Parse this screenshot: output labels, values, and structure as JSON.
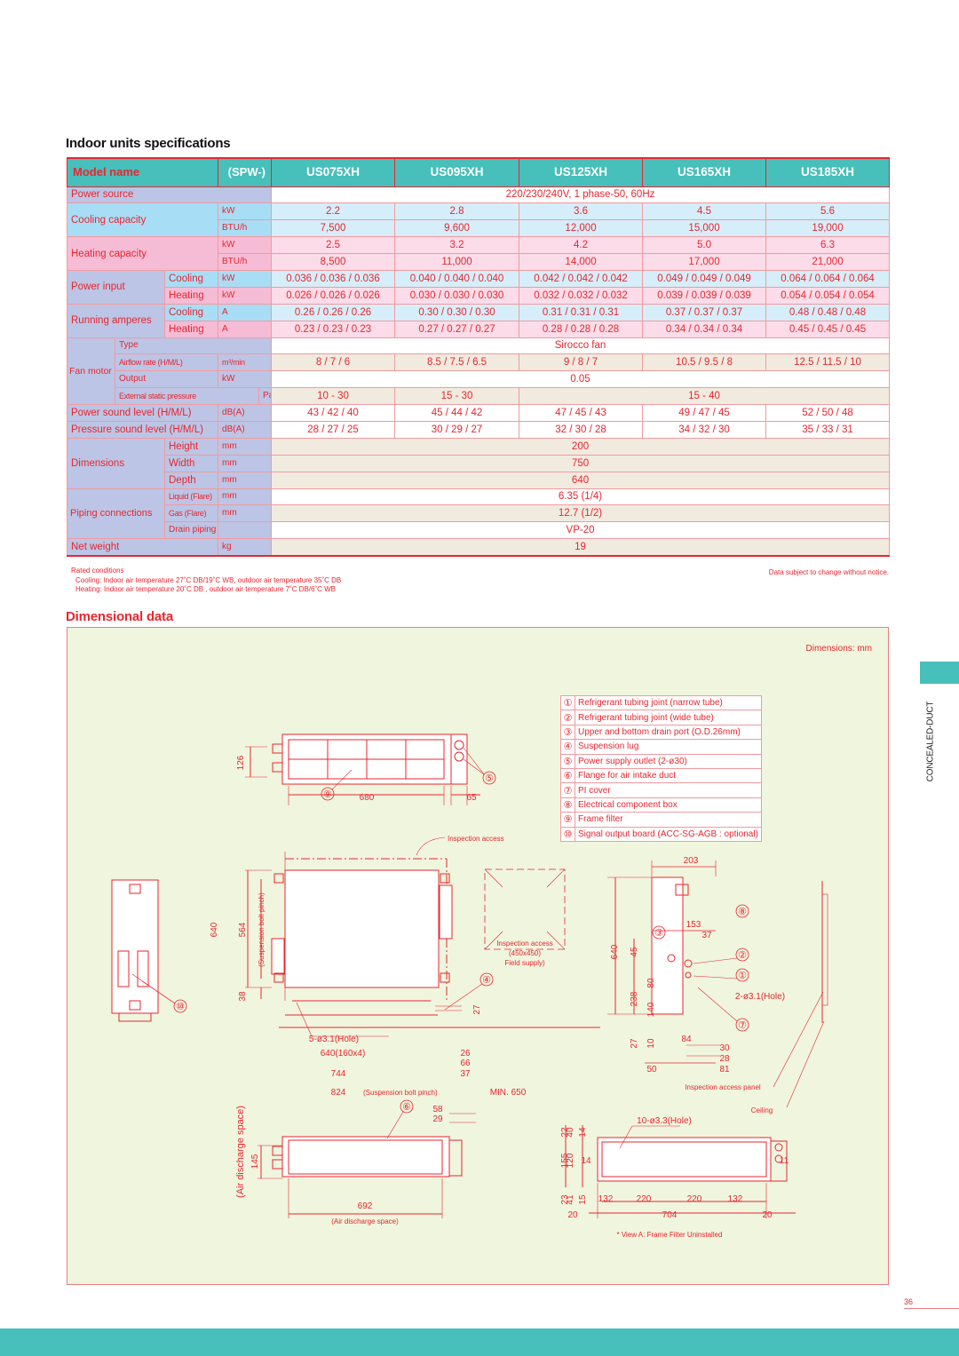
{
  "spec_section": {
    "title": "Indoor units specifications",
    "header": {
      "model_name": "Model name",
      "series": "(SPW-)",
      "models": [
        "US075XH",
        "US095XH",
        "US125XH",
        "US165XH",
        "US185XH"
      ]
    },
    "power_source": {
      "label": "Power source",
      "value": "220/230/240V, 1 phase-50, 60Hz"
    },
    "cooling_capacity": {
      "label": "Cooling capacity",
      "kw_unit": "kW",
      "kw": [
        "2.2",
        "2.8",
        "3.6",
        "4.5",
        "5.6"
      ],
      "btu_unit": "BTU/h",
      "btu": [
        "7,500",
        "9,600",
        "12,000",
        "15,000",
        "19,000"
      ]
    },
    "heating_capacity": {
      "label": "Heating capacity",
      "kw_unit": "kW",
      "kw": [
        "2.5",
        "3.2",
        "4.2",
        "5.0",
        "6.3"
      ],
      "btu_unit": "BTU/h",
      "btu": [
        "8,500",
        "11,000",
        "14,000",
        "17,000",
        "21,000"
      ]
    },
    "power_input": {
      "label": "Power input",
      "cooling_label": "Cooling",
      "cooling_unit": "kW",
      "cooling": [
        "0.036 / 0.036 / 0.036",
        "0.040 / 0.040 / 0.040",
        "0.042 / 0.042 / 0.042",
        "0.049 / 0.049 / 0.049",
        "0.064 / 0.064 / 0.064"
      ],
      "heating_label": "Heating",
      "heating_unit": "kW",
      "heating": [
        "0.026 / 0.026 / 0.026",
        "0.030 / 0.030 / 0.030",
        "0.032 / 0.032 / 0.032",
        "0.039 / 0.039 / 0.039",
        "0.054 / 0.054 / 0.054"
      ]
    },
    "running_amperes": {
      "label": "Running amperes",
      "cooling_label": "Cooling",
      "cooling_unit": "A",
      "cooling": [
        "0.26 / 0.26 / 0.26",
        "0.30 / 0.30 / 0.30",
        "0.31 / 0.31 / 0.31",
        "0.37 / 0.37 / 0.37",
        "0.48 / 0.48 / 0.48"
      ],
      "heating_label": "Heating",
      "heating_unit": "A",
      "heating": [
        "0.23 / 0.23 / 0.23",
        "0.27 / 0.27 / 0.27",
        "0.28 / 0.28 / 0.28",
        "0.34 / 0.34 / 0.34",
        "0.45 / 0.45 / 0.45"
      ]
    },
    "fan_motor": {
      "label": "Fan motor",
      "type_label": "Type",
      "type_value": "Sirocco fan",
      "airflow_label": "Airflow rate (H/M/L)",
      "airflow_unit": "m³/min",
      "airflow": [
        "8 / 7 / 6",
        "8.5 / 7.5 / 6.5",
        "9 / 8 / 7",
        "10.5 / 9.5 / 8",
        "12.5 / 11.5 / 10"
      ],
      "output_label": "Output",
      "output_unit": "kW",
      "output_value": "0.05",
      "esp_label": "External static pressure",
      "esp_unit": "Pa",
      "esp": [
        "10 - 30",
        "15 - 30",
        "15 - 40"
      ]
    },
    "power_sound": {
      "label": "Power sound level (H/M/L)",
      "unit": "dB(A)",
      "values": [
        "43 / 42 / 40",
        "45 / 44 / 42",
        "47 / 45 / 43",
        "49 / 47 / 45",
        "52 / 50 / 48"
      ]
    },
    "pressure_sound": {
      "label": "Pressure sound level (H/M/L)",
      "unit": "dB(A)",
      "values": [
        "28 / 27 / 25",
        "30 / 29 / 27",
        "32 / 30 / 28",
        "34 / 32 / 30",
        "35 / 33 / 31"
      ]
    },
    "dimensions": {
      "label": "Dimensions",
      "height_label": "Height",
      "height_unit": "mm",
      "height": "200",
      "width_label": "Width",
      "width_unit": "mm",
      "width": "750",
      "depth_label": "Depth",
      "depth_unit": "mm",
      "depth": "640"
    },
    "piping": {
      "label": "Piping connections",
      "liquid_label": "Liquid (Flare)",
      "liquid_unit": "mm",
      "liquid": "6.35 (1/4)",
      "gas_label": "Gas (Flare)",
      "gas_unit": "mm",
      "gas": "12.7 (1/2)",
      "drain_label": "Drain piping",
      "drain": "VP-20"
    },
    "net_weight": {
      "label": "Net weight",
      "unit": "kg",
      "value": "19"
    },
    "notes": {
      "title": "Rated conditions",
      "cooling": "Cooling: Indoor air temperature 27˚C DB/19˚C WB, outdoor air temperature 35˚C DB",
      "heating": "Heating: Indoor air temperature 20˚C DB , outdoor air temperature 7˚C DB/6˚C WB"
    },
    "disclaimer": "Data subject to change without notice."
  },
  "dim_section": {
    "title": "Dimensional data",
    "unit_note": "Dimensions: mm",
    "legend": [
      {
        "num": "①",
        "text": "Refrigerant tubing joint (narrow tube)"
      },
      {
        "num": "②",
        "text": "Refrigerant tubing joint (wide tube)"
      },
      {
        "num": "③",
        "text": "Upper and bottom drain port (O.D.26mm)"
      },
      {
        "num": "④",
        "text": "Suspension lug"
      },
      {
        "num": "⑤",
        "text": "Power supply outlet (2-ø30)"
      },
      {
        "num": "⑥",
        "text": "Flange for air intake duct"
      },
      {
        "num": "⑦",
        "text": "PI cover"
      },
      {
        "num": "⑧",
        "text": "Electrical component box"
      },
      {
        "num": "⑨",
        "text": "Frame filter"
      },
      {
        "num": "⑩",
        "text": "Signal output board (ACC-SG-AGB : optional)"
      }
    ],
    "labels": {
      "d126": "126",
      "d680": "680",
      "d65": "65",
      "c9": "⑨",
      "c5": "⑤",
      "inspection_access": "Inspection access",
      "d640": "640",
      "d564": "564",
      "bolt_pinch_v": "(Suspension bolt pinch)",
      "d38": "38",
      "hole5": "5-ø3.1(Hole)",
      "d640x": "640(160x4)",
      "d744": "744",
      "d824": "824",
      "bolt_pinch_h": "(Suspension bolt pinch)",
      "d26": "26",
      "d66": "66",
      "d37b": "37",
      "d27": "27",
      "c4": "④",
      "c10": "⑩",
      "min650": "MIN. 650",
      "insp_box_1": "Inspection access",
      "insp_box_2": "(450x450)",
      "insp_box_3": "Field supply)",
      "d203": "203",
      "d153": "153",
      "d37": "37",
      "d640r": "640",
      "d45": "45",
      "d238": "238",
      "d80": "80",
      "d140": "140",
      "d27r": "27",
      "d10": "10",
      "d84": "84",
      "d30": "30",
      "d28": "28",
      "d81": "81",
      "d50": "50",
      "hole2": "2-ø3.1(Hole)",
      "c8": "⑧",
      "c3": "③",
      "c2": "②",
      "c1": "①",
      "c7": "⑦",
      "insp_panel": "Inspection access panel",
      "ceiling": "Ceiling",
      "c6": "⑥",
      "d58": "58",
      "d29": "29",
      "d145": "145",
      "air_discharge_v": "(Air discharge space)",
      "d692": "692",
      "air_discharge_h": "(Air discharge space)",
      "hole10": "10-ø3.3(Hole)",
      "d22": "22",
      "d40": "40",
      "d14a": "14",
      "d155": "155",
      "d120": "120",
      "d14b": "14",
      "d23": "23",
      "d41": "41",
      "d15": "15",
      "d11": "11",
      "d132a": "132",
      "d220a": "220",
      "d220b": "220",
      "d132b": "132",
      "d20a": "20",
      "d704": "704",
      "d20b": "20",
      "view_a": "* View A: Frame Filter Uninstalled"
    }
  },
  "side_label": "CONCEALED-DUCT",
  "page_number": "36",
  "colors": {
    "teal": "#47bfbb",
    "red": "#e8262f",
    "drawing_bg": "#f0f5de"
  }
}
